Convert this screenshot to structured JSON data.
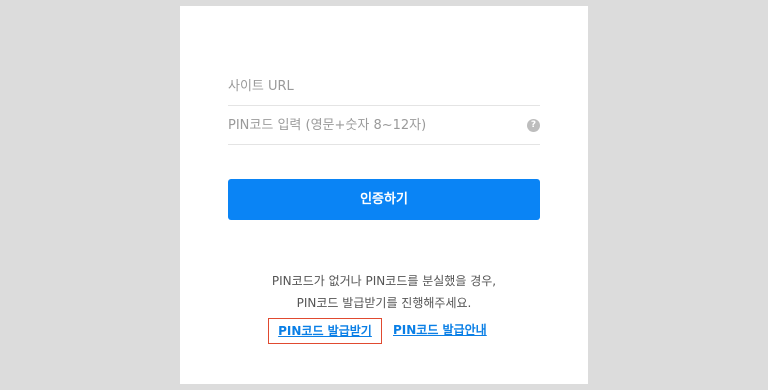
{
  "form": {
    "site_url_placeholder": "사이트 URL",
    "pin_placeholder": "PIN코드 입력 (영문+숫자 8~12자)",
    "help_icon_glyph": "?",
    "submit_label": "인증하기"
  },
  "notice": {
    "line1": "PIN코드가 없거나 PIN코드를 분실했을 경우,",
    "line2": "PIN코드 발급받기를 진행해주세요."
  },
  "links": {
    "issue_label": "PIN코드 발급받기",
    "guide_label": "PIN코드 발급안내"
  },
  "colors": {
    "primary": "#0a84f5",
    "highlight_border": "#e04a30",
    "link": "#0a7fe6"
  }
}
